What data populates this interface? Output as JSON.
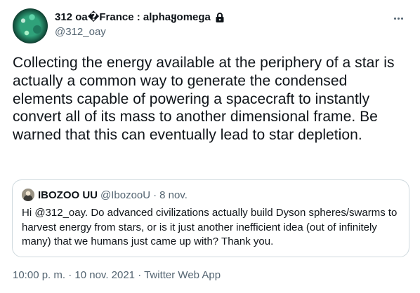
{
  "author": {
    "display_name": "312 oa�France : alphaყomega",
    "handle": "@312_oay",
    "avatar": "galaxy-avatar",
    "protected_icon": "lock-icon"
  },
  "more_icon": "more-horizontal-icon",
  "tweet": {
    "text": "Collecting the energy available at the periphery of a star is actually a common way to generate the condensed elements capable of powering a spacecraft to instantly convert all of its mass to another dimensional frame. Be warned that this can eventually lead to star depletion."
  },
  "quoted": {
    "display_name": "IBOZOO UU",
    "handle": "@IbozooU",
    "separator": "·",
    "date": "8 nov.",
    "text": "Hi @312_oay. Do advanced civilizations actually build Dyson spheres/swarms to harvest energy from stars, or is it just another inefficient idea (out of infinitely many) that we humans just came up with? Thank you."
  },
  "meta": {
    "time": "10:00 p. m.",
    "separator": " · ",
    "date": "10 nov. 2021",
    "client": "Twitter Web App"
  },
  "colors": {
    "text": "#0f1419",
    "secondary": "#536471",
    "border": "#cfd9de"
  }
}
